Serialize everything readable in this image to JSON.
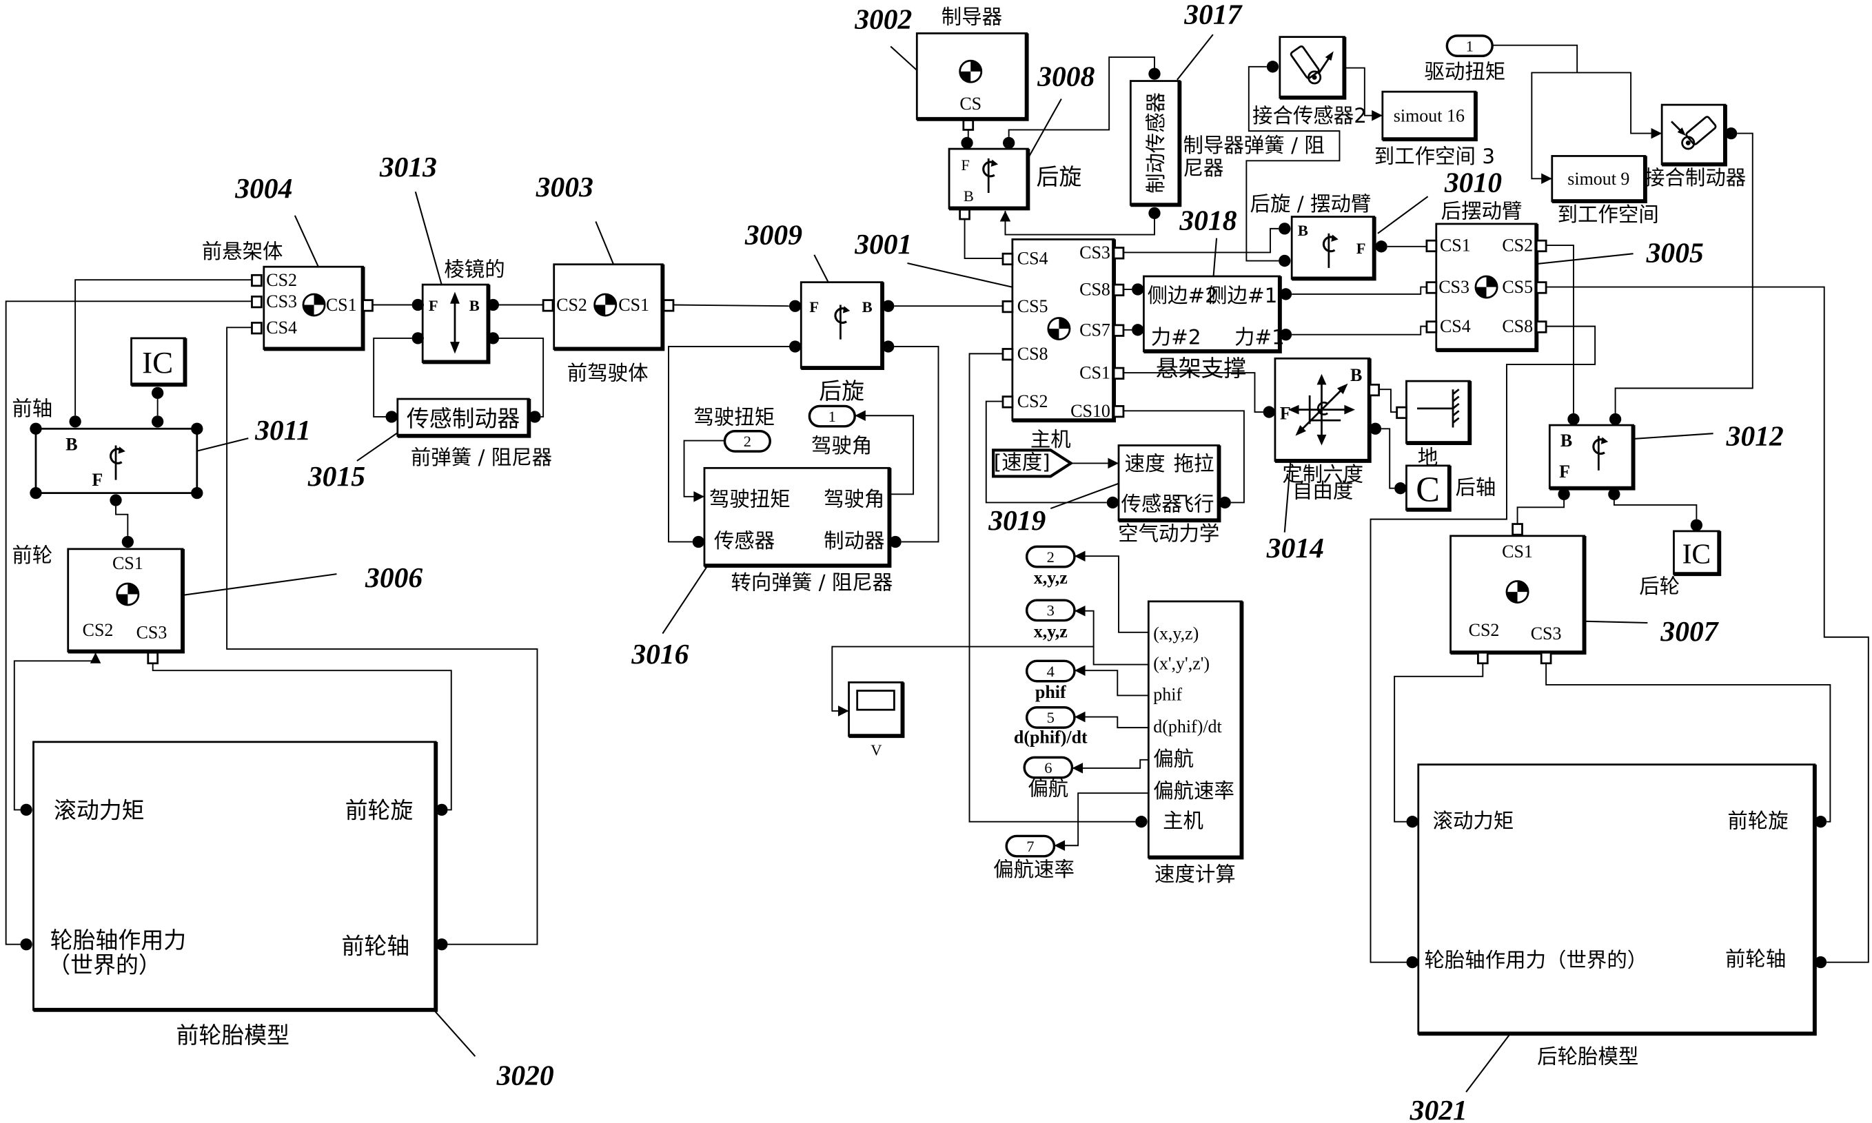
{
  "figure_refs": {
    "r3001": "3001",
    "r3002": "3002",
    "r3003": "3003",
    "r3004": "3004",
    "r3005": "3005",
    "r3006": "3006",
    "r3007": "3007",
    "r3008": "3008",
    "r3009": "3009",
    "r3010": "3010",
    "r3011": "3011",
    "r3012": "3012",
    "r3013": "3013",
    "r3014": "3014",
    "r3015": "3015",
    "r3016": "3016",
    "r3017": "3017",
    "r3018": "3018",
    "r3019": "3019",
    "r3020": "3020",
    "r3021": "3021"
  },
  "blocks": {
    "guide": {
      "title": "制导器",
      "port": "CS"
    },
    "guide_joint": {
      "label": "后旋",
      "f": "F",
      "b": "B"
    },
    "brake_sensor": {
      "title": "制动传感器",
      "spring_label_line1": "制导器弹簧 / 阻",
      "spring_label_line2": "尼器"
    },
    "joint_sensor_2": {
      "label": "接合传感器2"
    },
    "simout_16": {
      "text": "simout 16",
      "label": "到工作空间 3"
    },
    "drive_torque_inport": {
      "number": "1",
      "label": "驱动扭矩"
    },
    "simout_9": {
      "text": "simout 9",
      "label": "到工作空间"
    },
    "joint_actuator": {
      "label": "接合制动器"
    },
    "front_suspension_body": {
      "title": "前悬架体",
      "cs1": "CS1",
      "cs2": "CS2",
      "cs3": "CS3",
      "cs4": "CS4"
    },
    "prismatic": {
      "title": "棱镜的",
      "f": "F",
      "b": "B"
    },
    "front_spring_damper": {
      "text": "传感制动器",
      "label": "前弹簧 / 阻尼器"
    },
    "front_steering_body": {
      "title": "前驾驶体",
      "cs1": "CS1",
      "cs2": "CS2"
    },
    "steering_joint": {
      "label": "后旋",
      "f": "F",
      "b": "B"
    },
    "steering_spring_damper": {
      "in_torque": "驾驶扭矩",
      "out_angle": "驾驶角",
      "sensor": "传感器",
      "actuator": "制动器",
      "label": "转向弹簧 / 阻尼器"
    },
    "steer_torque_inport": {
      "number": "2",
      "label": "驾驶扭矩"
    },
    "steer_angle_outport": {
      "number": "1",
      "label": "驾驶角"
    },
    "main_body": {
      "title": "主机",
      "left_ports": [
        "CS4",
        "CS5",
        "CS8",
        "CS2"
      ],
      "right_ports": [
        "CS3",
        "CS8",
        "CS7",
        "CS1",
        "CS10"
      ]
    },
    "suspension_strut": {
      "title": "悬架支撑",
      "side2": "侧边#2",
      "side1": "侧边#1",
      "force2": "力#2",
      "force1": "力#1"
    },
    "swing_arm_joint": {
      "label": "后旋 / 摆动臂",
      "b": "B",
      "f": "F"
    },
    "rear_swing_arm": {
      "title": "后摆动臂",
      "left_ports": [
        "CS1",
        "CS3",
        "CS4"
      ],
      "right_ports": [
        "CS2",
        "CS5",
        "CS8"
      ]
    },
    "six_dof": {
      "label_line1": "定制六度",
      "label_line2": "自由度",
      "f": "F",
      "b": "B"
    },
    "ground": {
      "label": "地"
    },
    "rear_axle_constraint": {
      "symbol": "C",
      "label": "后轴"
    },
    "aerodynamics": {
      "speed": "速度",
      "drag": "拖拉",
      "sensor": "传感器",
      "flight": "飞行",
      "label": "空气动力学"
    },
    "speed_tag": {
      "text": "[速度]"
    },
    "speed_calc": {
      "ports": [
        "(x,y,z)",
        "(x',y',z')",
        "phif",
        "d(phif)/dt",
        "偏航",
        "偏航速率",
        "主机"
      ],
      "label": "速度计算"
    },
    "outports": [
      {
        "number": "2",
        "label": "x,y,z"
      },
      {
        "number": "3",
        "label": "x,y,z"
      },
      {
        "number": "4",
        "label": "phif"
      },
      {
        "number": "5",
        "label": "d(phif)/dt"
      },
      {
        "number": "6",
        "label": "偏航"
      },
      {
        "number": "7",
        "label": "偏航速率"
      }
    ],
    "scope": {
      "label": "V"
    },
    "front_axle_joint": {
      "label": "前轴",
      "b": "B",
      "f": "F"
    },
    "front_ic": {
      "symbol": "IC"
    },
    "front_wheel": {
      "label": "前轮",
      "cs1": "CS1",
      "cs2": "CS2",
      "cs3": "CS3"
    },
    "front_tire_model": {
      "rolling_torque": "滚动力矩",
      "wheel_rev": "前轮旋",
      "axle_force_line1": "轮胎轴作用力",
      "axle_force_line2": "（世界的）",
      "axle": "前轮轴",
      "label": "前轮胎模型"
    },
    "rear_joint": {
      "b": "B",
      "f": "F"
    },
    "rear_ic": {
      "symbol": "IC"
    },
    "rear_wheel": {
      "label": "后轮",
      "cs1": "CS1",
      "cs2": "CS2",
      "cs3": "CS3"
    },
    "rear_tire_model": {
      "rolling_torque": "滚动力矩",
      "wheel_rev": "前轮旋",
      "axle_force": "轮胎轴作用力（世界的）",
      "axle": "前轮轴",
      "label": "后轮胎模型"
    }
  }
}
